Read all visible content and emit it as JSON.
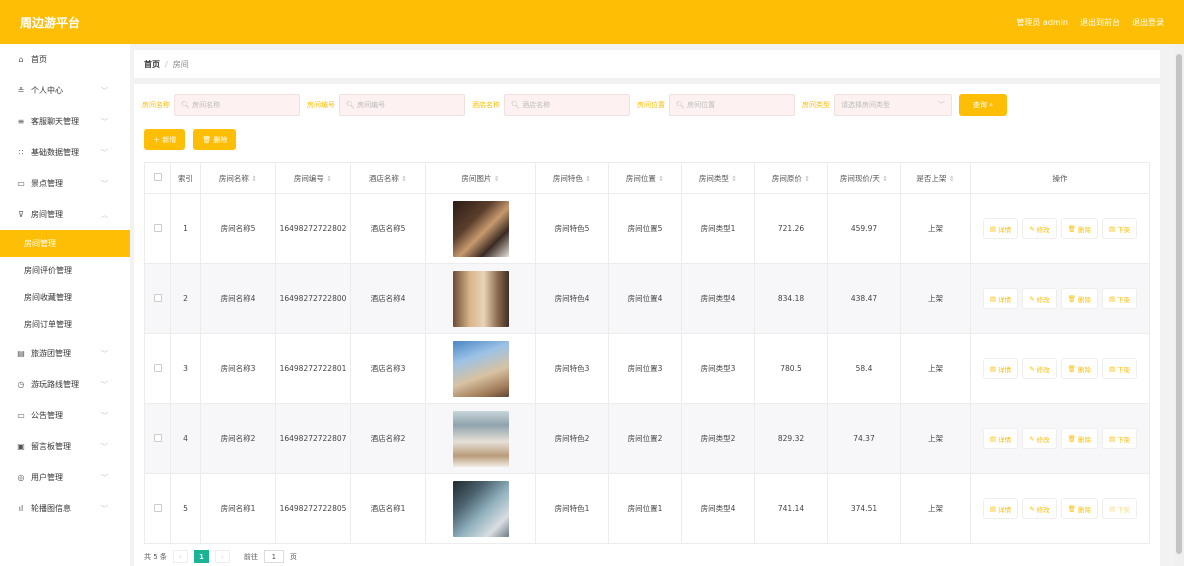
{
  "header": {
    "brand": "周边游平台",
    "admin_label": "管理员 admin",
    "back_label": "退出到前台",
    "logout_label": "退出登录"
  },
  "sidebar": {
    "items": [
      {
        "label": "首页",
        "icon": "home-icon",
        "glyph": "⌂"
      },
      {
        "label": "个人中心",
        "icon": "user-icon",
        "glyph": "≗"
      },
      {
        "label": "客服聊天管理",
        "icon": "menu-icon",
        "glyph": "≡"
      },
      {
        "label": "基础数据管理",
        "icon": "grid-icon",
        "glyph": "∷"
      },
      {
        "label": "景点管理",
        "icon": "window-icon",
        "glyph": "▭"
      },
      {
        "label": "房间管理",
        "icon": "filter-icon",
        "glyph": "⊽"
      },
      {
        "label": "旅游团管理",
        "icon": "list-icon",
        "glyph": "▤"
      },
      {
        "label": "游玩路线管理",
        "icon": "clock-icon",
        "glyph": "◷"
      },
      {
        "label": "公告管理",
        "icon": "chat-icon",
        "glyph": "▭"
      },
      {
        "label": "留言板管理",
        "icon": "message-icon",
        "glyph": "▣"
      },
      {
        "label": "用户管理",
        "icon": "users-icon",
        "glyph": "◎"
      },
      {
        "label": "轮播图信息",
        "icon": "chart-icon",
        "glyph": "ıl"
      }
    ],
    "sub_items": [
      "房间管理",
      "房间评价管理",
      "房间收藏管理",
      "房间订单管理"
    ]
  },
  "breadcrumb": {
    "home": "首页",
    "sep": "/",
    "current": "房间"
  },
  "search": {
    "fields": [
      {
        "label": "房间名称",
        "placeholder": "房间名称"
      },
      {
        "label": "房间编号",
        "placeholder": "房间编号"
      },
      {
        "label": "酒店名称",
        "placeholder": "酒店名称"
      },
      {
        "label": "房间位置",
        "placeholder": "房间位置"
      }
    ],
    "type_label": "房间类型",
    "type_placeholder": "请选择房间类型",
    "search_button": "查询"
  },
  "actions": {
    "add": "新增",
    "delete": "删除"
  },
  "table": {
    "headers": [
      "索引",
      "房间名称",
      "房间编号",
      "酒店名称",
      "房间图片",
      "房间特色",
      "房间位置",
      "房间类型",
      "房间原价",
      "房间现价/天",
      "是否上架",
      "操作"
    ],
    "rows": [
      {
        "idx": "1",
        "name": "房间名称5",
        "code": "16498272722802",
        "hotel": "酒店名称5",
        "feature": "房间特色5",
        "location": "房间位置5",
        "type": "房间类型1",
        "price": "721.26",
        "now": "459.97",
        "status": "上架"
      },
      {
        "idx": "2",
        "name": "房间名称4",
        "code": "16498272722800",
        "hotel": "酒店名称4",
        "feature": "房间特色4",
        "location": "房间位置4",
        "type": "房间类型4",
        "price": "834.18",
        "now": "438.47",
        "status": "上架"
      },
      {
        "idx": "3",
        "name": "房间名称3",
        "code": "16498272722801",
        "hotel": "酒店名称3",
        "feature": "房间特色3",
        "location": "房间位置3",
        "type": "房间类型3",
        "price": "780.5",
        "now": "58.4",
        "status": "上架"
      },
      {
        "idx": "4",
        "name": "房间名称2",
        "code": "16498272722807",
        "hotel": "酒店名称2",
        "feature": "房间特色2",
        "location": "房间位置2",
        "type": "房间类型2",
        "price": "829.32",
        "now": "74.37",
        "status": "上架"
      },
      {
        "idx": "5",
        "name": "房间名称1",
        "code": "16498272722805",
        "hotel": "酒店名称1",
        "feature": "房间特色1",
        "location": "房间位置1",
        "type": "房间类型4",
        "price": "741.14",
        "now": "374.51",
        "status": "上架"
      }
    ],
    "ops": {
      "detail": "详情",
      "edit": "修改",
      "delete": "删除",
      "offshelf": "下架"
    }
  },
  "pagination": {
    "total": "共 5 条",
    "page": "1",
    "goto": "前往",
    "goto_value": "1",
    "unit": "页"
  },
  "colors": {
    "accent": "#fdbe05",
    "pager": "#1ab394"
  }
}
